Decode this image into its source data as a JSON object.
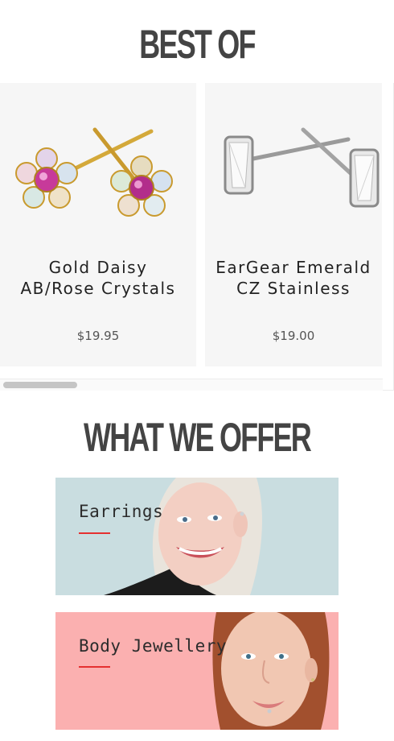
{
  "sections": {
    "best_of_title": "BEST OF",
    "what_we_offer_title": "WHAT WE OFFER"
  },
  "products": [
    {
      "name_line1": "Gold Daisy",
      "name_line2": "AB/Rose Crystals",
      "price": "$19.95"
    },
    {
      "name_line1": "EarGear Emerald",
      "name_line2": "CZ Stainless",
      "price": "$19.00"
    }
  ],
  "offers": [
    {
      "label": "Earrings"
    },
    {
      "label": "Body Jewellery"
    }
  ],
  "colors": {
    "accent_underline": "#e53030",
    "earrings_bg": "#c9dde0",
    "body_jewellery_bg": "#fbb0b0",
    "card_bg": "#f6f6f6"
  }
}
